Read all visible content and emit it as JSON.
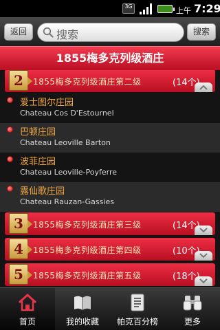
{
  "status_bar": {
    "network": "3G",
    "ampm": "上午",
    "time": "7:29"
  },
  "top_bar": {
    "back_label": "返回",
    "search_placeholder": "搜索",
    "search_button_label": "搜索"
  },
  "title": "1855梅多克列级酒庄",
  "groups": [
    {
      "number": "2",
      "title": "1855梅多克列级酒庄第二级",
      "count": "(14个)",
      "expanded": true
    },
    {
      "number": "3",
      "title": "1855梅多克列级酒庄第三级",
      "count": "(14个)",
      "expanded": false
    },
    {
      "number": "4",
      "title": "1855梅多克列级酒庄第四级",
      "count": "(10个)",
      "expanded": false
    },
    {
      "number": "5",
      "title": "1855梅多克列级酒庄第五级",
      "count": "(18个)",
      "expanded": false
    }
  ],
  "items": [
    {
      "name_cn": "爱士图尔庄园",
      "name_en": "Chateau Cos D'Estournel"
    },
    {
      "name_cn": "巴顿庄园",
      "name_en": "Chateau Leoville Barton"
    },
    {
      "name_cn": "波菲庄园",
      "name_en": "Chateau Leoville-Poyferre"
    },
    {
      "name_cn": "露仙歌庄园",
      "name_en": "Chateau Rauzan-Gassies"
    }
  ],
  "tabs": [
    {
      "label": "首页",
      "icon": "home-icon",
      "active": true
    },
    {
      "label": "我的收藏",
      "icon": "book-icon",
      "active": false
    },
    {
      "label": "帕克百分榜",
      "icon": "list-icon",
      "active": false
    },
    {
      "label": "更多",
      "icon": "binoculars-icon",
      "active": false
    }
  ],
  "colors": {
    "accent_red": "#d8182e",
    "item_cn_text": "#f0a640",
    "number_badge": "#e6c270"
  }
}
